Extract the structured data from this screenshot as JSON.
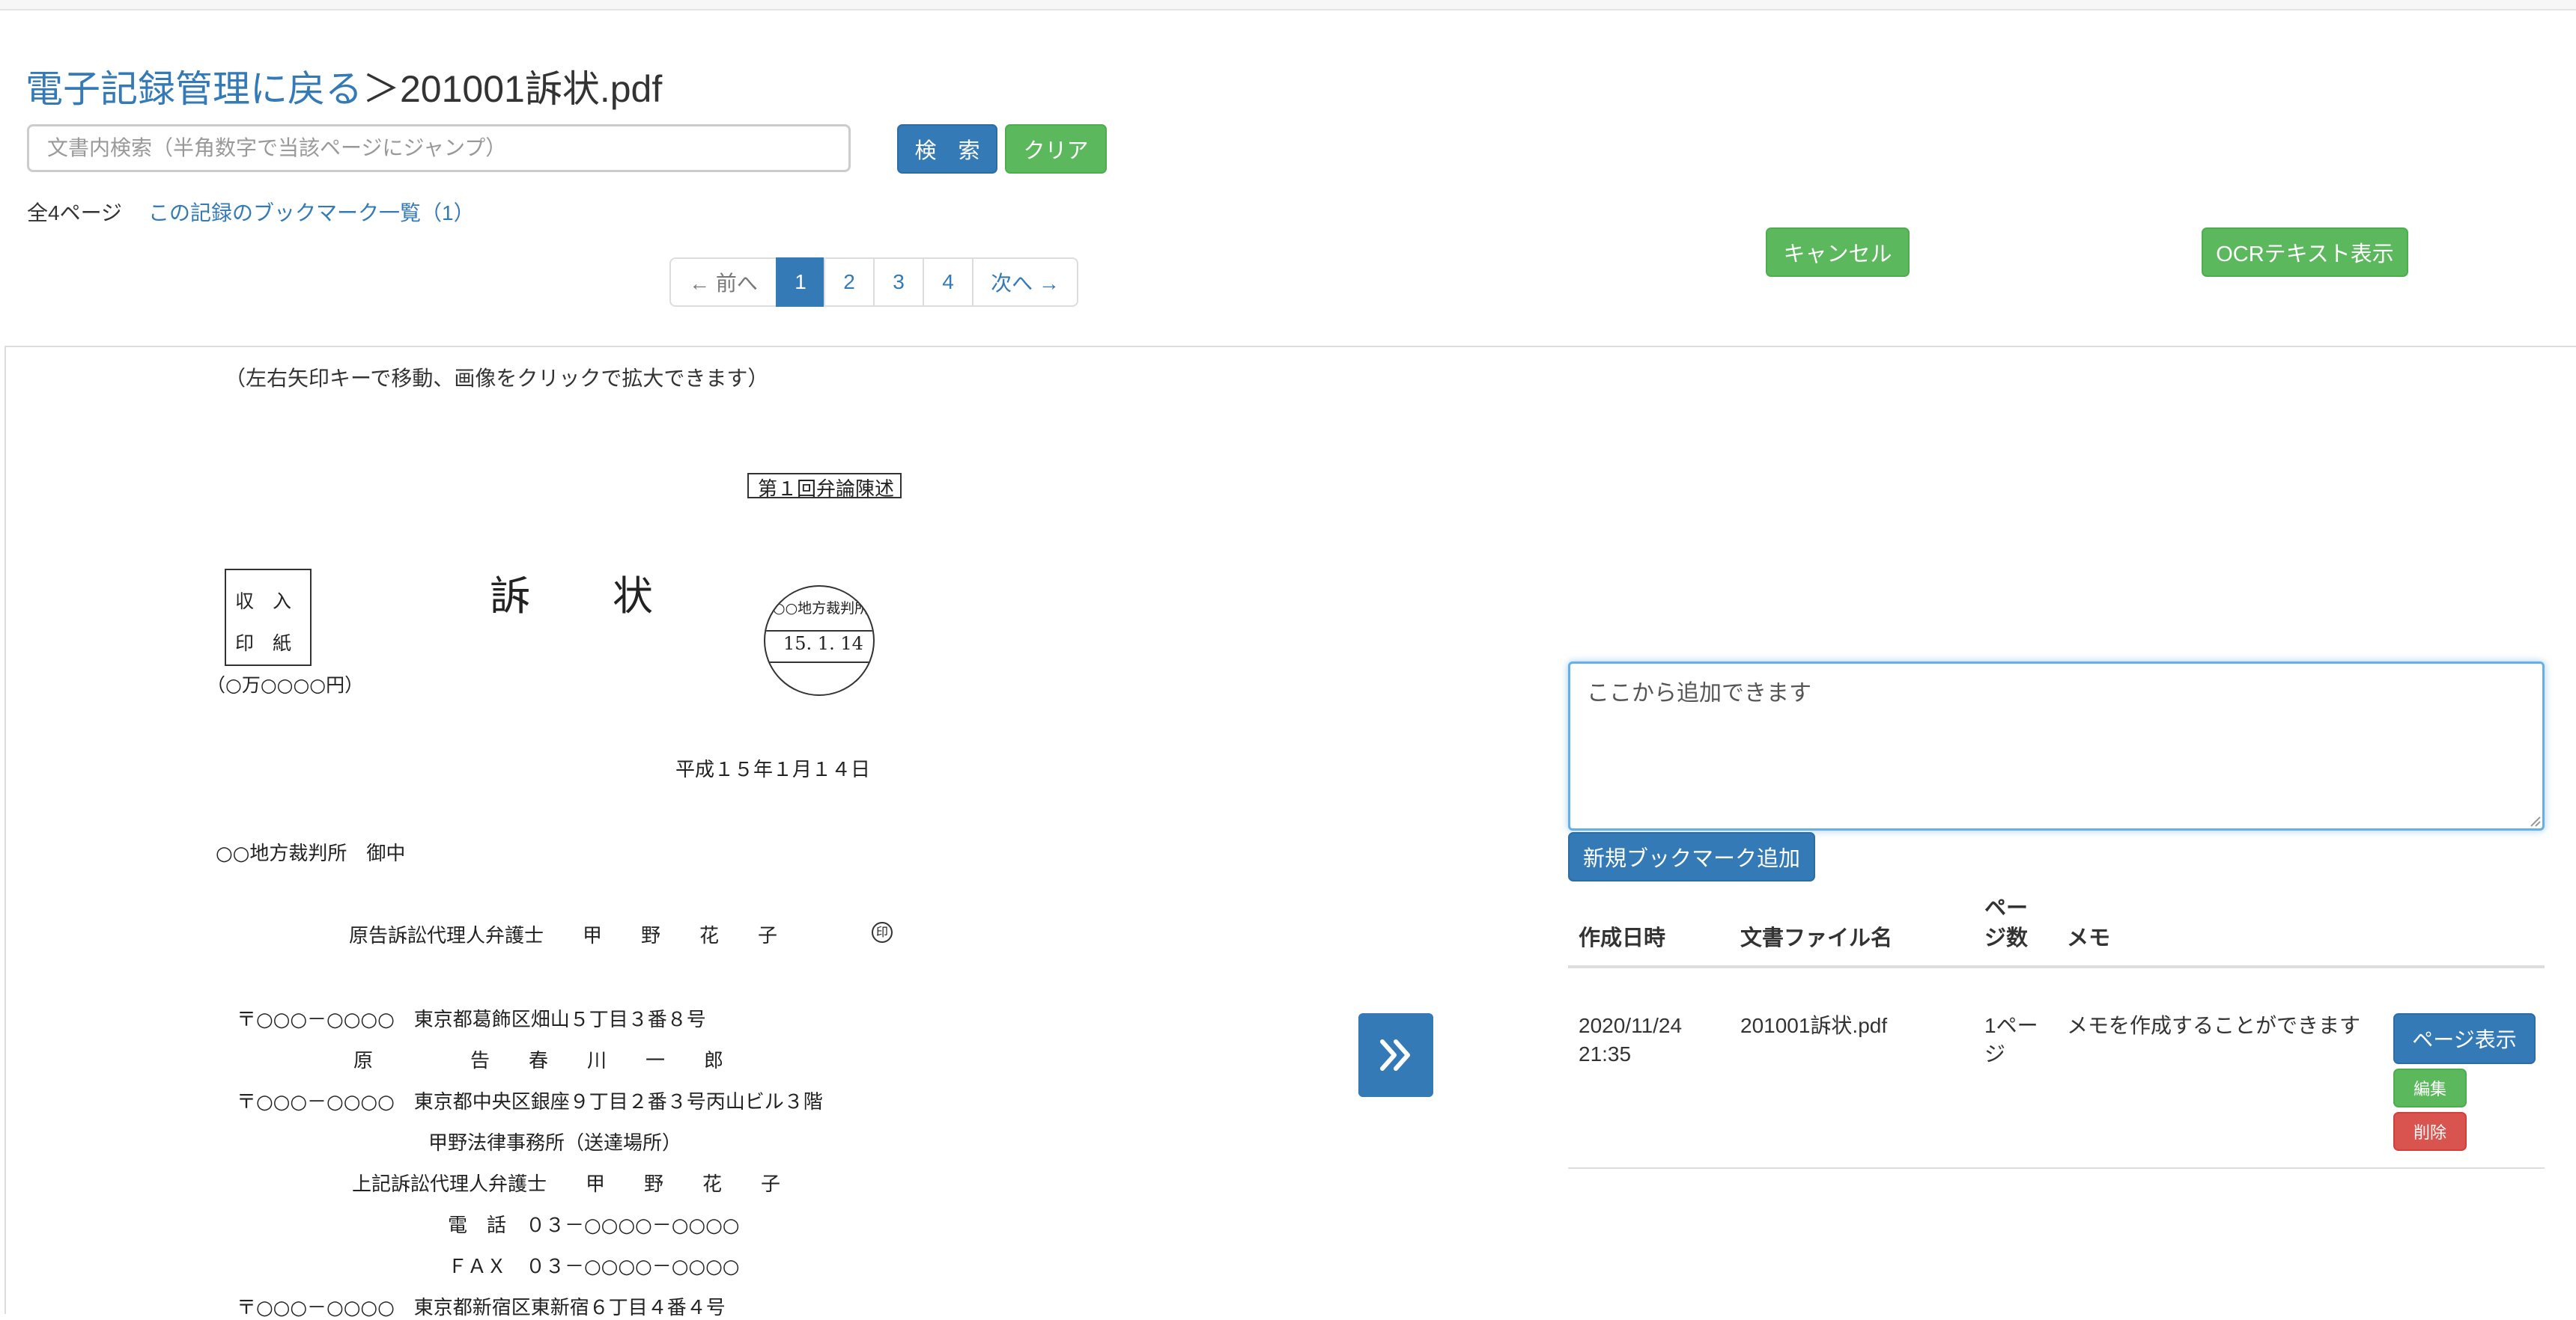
{
  "breadcrumb": {
    "back_link": "電子記録管理に戻る",
    "separator": "＞",
    "file_name": "201001訴状.pdf"
  },
  "search": {
    "placeholder": "文書内検索（半角数字で当該ページにジャンプ）",
    "search_label": "検　索",
    "clear_label": "クリア"
  },
  "info": {
    "page_count": "全4ページ",
    "bookmark_link": "この記録のブックマーク一覧（1）"
  },
  "actions": {
    "cancel_label": "キャンセル",
    "ocr_label": "OCRテキスト表示"
  },
  "pagination": {
    "prev": "← 前へ",
    "pages": [
      "1",
      "2",
      "3",
      "4"
    ],
    "active": "1",
    "next": "次へ →"
  },
  "viewer": {
    "instructions": "（左右矢印キーで移動、画像をクリックで拡大できます）",
    "next_icon": "double-chevron-right-icon"
  },
  "document": {
    "heading_box": "第１回弁論陳述",
    "title_1": "訴",
    "title_2": "状",
    "stamp_box_1": "収　入",
    "stamp_box_2": "印　紙",
    "stamp_amount": "（○万○○○○円）",
    "court_stamp_top": "○○地方裁判所",
    "court_stamp_date": "15. 1. 14",
    "date": "平成１５年１月１４日",
    "addressee": "○○地方裁判所　御中",
    "agent_line": "原告訴訟代理人弁護士　　甲　　野　　花　　子",
    "seal_mark": "印",
    "lines": [
      "〒○○○－○○○○　東京都葛飾区畑山５丁目３番８号",
      "原　　　　　告　　春　　川　　一　　郎",
      "〒○○○－○○○○　東京都中央区銀座９丁目２番３号丙山ビル３階",
      "甲野法律事務所（送達場所）",
      "上記訴訟代理人弁護士　　甲　　野　　花　　子",
      "電　話　０３－○○○○－○○○○",
      "ＦＡＸ　０３－○○○○－○○○○",
      "〒○○○－○○○○　東京都新宿区東新宿６丁目４番４号"
    ]
  },
  "bookmark_form": {
    "textarea_value": "ここから追加できます",
    "add_label": "新規ブックマーク追加"
  },
  "bookmark_table": {
    "headers": {
      "created": "作成日時",
      "file": "文書ファイル名",
      "page_1": "ペー",
      "page_2": "ジ数",
      "memo": "メモ"
    },
    "rows": [
      {
        "date": "2020/11/24",
        "time": "21:35",
        "file": "201001訴状.pdf",
        "page_1": "1ペー",
        "page_2": "ジ",
        "memo": "メモを作成することができます",
        "show_label": "ページ表示",
        "edit_label": "編集",
        "delete_label": "削除"
      }
    ]
  },
  "colors": {
    "primary": "#337ab7",
    "success": "#5cb85c",
    "danger": "#d9534f",
    "link": "#337ab7"
  }
}
